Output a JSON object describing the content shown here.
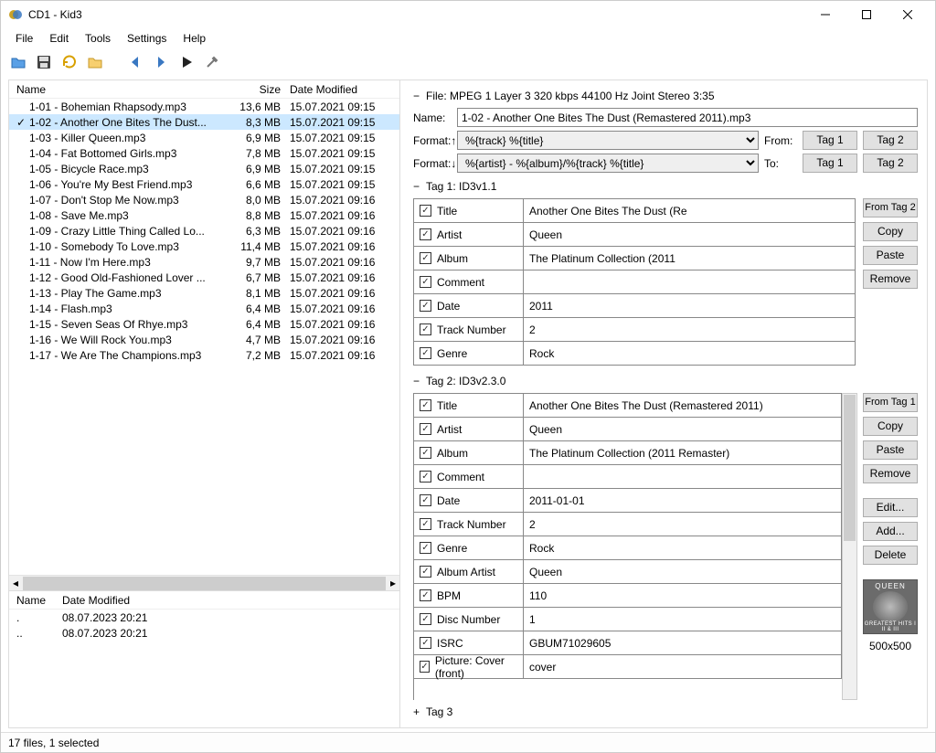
{
  "window": {
    "title": "CD1 - Kid3"
  },
  "menu": {
    "file": "File",
    "edit": "Edit",
    "tools": "Tools",
    "settings": "Settings",
    "help": "Help"
  },
  "filelist": {
    "headers": {
      "name": "Name",
      "size": "Size",
      "date": "Date Modified"
    },
    "rows": [
      {
        "name": "1-01 - Bohemian Rhapsody.mp3",
        "size": "13,6 MB",
        "date": "15.07.2021 09:15"
      },
      {
        "name": "1-02 - Another One Bites The Dust...",
        "size": "8,3 MB",
        "date": "15.07.2021 09:15",
        "selected": true
      },
      {
        "name": "1-03 - Killer Queen.mp3",
        "size": "6,9 MB",
        "date": "15.07.2021 09:15"
      },
      {
        "name": "1-04 - Fat Bottomed Girls.mp3",
        "size": "7,8 MB",
        "date": "15.07.2021 09:15"
      },
      {
        "name": "1-05 - Bicycle Race.mp3",
        "size": "6,9 MB",
        "date": "15.07.2021 09:15"
      },
      {
        "name": "1-06 - You're My Best Friend.mp3",
        "size": "6,6 MB",
        "date": "15.07.2021 09:15"
      },
      {
        "name": "1-07 - Don't Stop Me Now.mp3",
        "size": "8,0 MB",
        "date": "15.07.2021 09:16"
      },
      {
        "name": "1-08 - Save Me.mp3",
        "size": "8,8 MB",
        "date": "15.07.2021 09:16"
      },
      {
        "name": "1-09 - Crazy Little Thing Called Lo...",
        "size": "6,3 MB",
        "date": "15.07.2021 09:16"
      },
      {
        "name": "1-10 - Somebody To Love.mp3",
        "size": "11,4 MB",
        "date": "15.07.2021 09:16"
      },
      {
        "name": "1-11 - Now I'm Here.mp3",
        "size": "9,7 MB",
        "date": "15.07.2021 09:16"
      },
      {
        "name": "1-12 - Good Old-Fashioned Lover ...",
        "size": "6,7 MB",
        "date": "15.07.2021 09:16"
      },
      {
        "name": "1-13 - Play The Game.mp3",
        "size": "8,1 MB",
        "date": "15.07.2021 09:16"
      },
      {
        "name": "1-14 - Flash.mp3",
        "size": "6,4 MB",
        "date": "15.07.2021 09:16"
      },
      {
        "name": "1-15 - Seven Seas Of Rhye.mp3",
        "size": "6,4 MB",
        "date": "15.07.2021 09:16"
      },
      {
        "name": "1-16 - We Will Rock You.mp3",
        "size": "4,7 MB",
        "date": "15.07.2021 09:16"
      },
      {
        "name": "1-17 - We Are The Champions.mp3",
        "size": "7,2 MB",
        "date": "15.07.2021 09:16"
      }
    ]
  },
  "dirlist": {
    "headers": {
      "name": "Name",
      "date": "Date Modified"
    },
    "rows": [
      {
        "name": ".",
        "date": "08.07.2023 20:21"
      },
      {
        "name": "..",
        "date": "08.07.2023 20:21"
      }
    ]
  },
  "file_info": {
    "label": "File:",
    "value": "MPEG 1 Layer 3 320 kbps 44100 Hz Joint Stereo 3:35"
  },
  "name_field": {
    "label": "Name:",
    "value": "1-02 - Another One Bites The Dust (Remastered 2011).mp3"
  },
  "format1": {
    "label": "Format:↑",
    "value": "%{track} %{title}",
    "from": "From:",
    "btn1": "Tag 1",
    "btn2": "Tag 2"
  },
  "format2": {
    "label": "Format:↓",
    "value": "%{artist} - %{album}/%{track} %{title}",
    "to": "To:",
    "btn1": "Tag 1",
    "btn2": "Tag 2"
  },
  "tag1": {
    "header": "Tag 1: ID3v1.1",
    "rows": [
      {
        "field": "Title",
        "value": "Another One Bites The Dust (Re"
      },
      {
        "field": "Artist",
        "value": "Queen"
      },
      {
        "field": "Album",
        "value": "The Platinum Collection (2011"
      },
      {
        "field": "Comment",
        "value": ""
      },
      {
        "field": "Date",
        "value": "2011"
      },
      {
        "field": "Track Number",
        "value": "2"
      },
      {
        "field": "Genre",
        "value": "Rock"
      }
    ],
    "buttons": {
      "from": "From Tag 2",
      "copy": "Copy",
      "paste": "Paste",
      "remove": "Remove"
    }
  },
  "tag2": {
    "header": "Tag 2: ID3v2.3.0",
    "rows": [
      {
        "field": "Title",
        "value": "Another One Bites The Dust (Remastered 2011)"
      },
      {
        "field": "Artist",
        "value": "Queen"
      },
      {
        "field": "Album",
        "value": "The Platinum Collection (2011 Remaster)"
      },
      {
        "field": "Comment",
        "value": ""
      },
      {
        "field": "Date",
        "value": "2011-01-01"
      },
      {
        "field": "Track Number",
        "value": "2"
      },
      {
        "field": "Genre",
        "value": "Rock"
      },
      {
        "field": "Album Artist",
        "value": "Queen"
      },
      {
        "field": "BPM",
        "value": "110"
      },
      {
        "field": "Disc Number",
        "value": "1"
      },
      {
        "field": "ISRC",
        "value": "GBUM71029605"
      },
      {
        "field": "Picture: Cover (front)",
        "value": "cover"
      }
    ],
    "buttons": {
      "from": "From Tag 1",
      "copy": "Copy",
      "paste": "Paste",
      "remove": "Remove",
      "edit": "Edit...",
      "add": "Add...",
      "delete": "Delete"
    },
    "cover_dim": "500x500",
    "cover_band": "QUEEN"
  },
  "tag3": {
    "header": "Tag 3"
  },
  "status": "17 files, 1 selected"
}
